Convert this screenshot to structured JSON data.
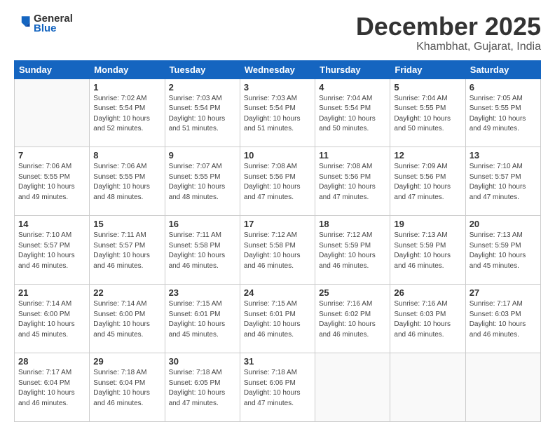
{
  "logo": {
    "general": "General",
    "blue": "Blue"
  },
  "header": {
    "month": "December 2025",
    "location": "Khambhat, Gujarat, India"
  },
  "weekdays": [
    "Sunday",
    "Monday",
    "Tuesday",
    "Wednesday",
    "Thursday",
    "Friday",
    "Saturday"
  ],
  "weeks": [
    [
      {
        "day": "",
        "info": ""
      },
      {
        "day": "1",
        "info": "Sunrise: 7:02 AM\nSunset: 5:54 PM\nDaylight: 10 hours\nand 52 minutes."
      },
      {
        "day": "2",
        "info": "Sunrise: 7:03 AM\nSunset: 5:54 PM\nDaylight: 10 hours\nand 51 minutes."
      },
      {
        "day": "3",
        "info": "Sunrise: 7:03 AM\nSunset: 5:54 PM\nDaylight: 10 hours\nand 51 minutes."
      },
      {
        "day": "4",
        "info": "Sunrise: 7:04 AM\nSunset: 5:54 PM\nDaylight: 10 hours\nand 50 minutes."
      },
      {
        "day": "5",
        "info": "Sunrise: 7:04 AM\nSunset: 5:55 PM\nDaylight: 10 hours\nand 50 minutes."
      },
      {
        "day": "6",
        "info": "Sunrise: 7:05 AM\nSunset: 5:55 PM\nDaylight: 10 hours\nand 49 minutes."
      }
    ],
    [
      {
        "day": "7",
        "info": "Sunrise: 7:06 AM\nSunset: 5:55 PM\nDaylight: 10 hours\nand 49 minutes."
      },
      {
        "day": "8",
        "info": "Sunrise: 7:06 AM\nSunset: 5:55 PM\nDaylight: 10 hours\nand 48 minutes."
      },
      {
        "day": "9",
        "info": "Sunrise: 7:07 AM\nSunset: 5:55 PM\nDaylight: 10 hours\nand 48 minutes."
      },
      {
        "day": "10",
        "info": "Sunrise: 7:08 AM\nSunset: 5:56 PM\nDaylight: 10 hours\nand 47 minutes."
      },
      {
        "day": "11",
        "info": "Sunrise: 7:08 AM\nSunset: 5:56 PM\nDaylight: 10 hours\nand 47 minutes."
      },
      {
        "day": "12",
        "info": "Sunrise: 7:09 AM\nSunset: 5:56 PM\nDaylight: 10 hours\nand 47 minutes."
      },
      {
        "day": "13",
        "info": "Sunrise: 7:10 AM\nSunset: 5:57 PM\nDaylight: 10 hours\nand 47 minutes."
      }
    ],
    [
      {
        "day": "14",
        "info": "Sunrise: 7:10 AM\nSunset: 5:57 PM\nDaylight: 10 hours\nand 46 minutes."
      },
      {
        "day": "15",
        "info": "Sunrise: 7:11 AM\nSunset: 5:57 PM\nDaylight: 10 hours\nand 46 minutes."
      },
      {
        "day": "16",
        "info": "Sunrise: 7:11 AM\nSunset: 5:58 PM\nDaylight: 10 hours\nand 46 minutes."
      },
      {
        "day": "17",
        "info": "Sunrise: 7:12 AM\nSunset: 5:58 PM\nDaylight: 10 hours\nand 46 minutes."
      },
      {
        "day": "18",
        "info": "Sunrise: 7:12 AM\nSunset: 5:59 PM\nDaylight: 10 hours\nand 46 minutes."
      },
      {
        "day": "19",
        "info": "Sunrise: 7:13 AM\nSunset: 5:59 PM\nDaylight: 10 hours\nand 46 minutes."
      },
      {
        "day": "20",
        "info": "Sunrise: 7:13 AM\nSunset: 5:59 PM\nDaylight: 10 hours\nand 45 minutes."
      }
    ],
    [
      {
        "day": "21",
        "info": "Sunrise: 7:14 AM\nSunset: 6:00 PM\nDaylight: 10 hours\nand 45 minutes."
      },
      {
        "day": "22",
        "info": "Sunrise: 7:14 AM\nSunset: 6:00 PM\nDaylight: 10 hours\nand 45 minutes."
      },
      {
        "day": "23",
        "info": "Sunrise: 7:15 AM\nSunset: 6:01 PM\nDaylight: 10 hours\nand 45 minutes."
      },
      {
        "day": "24",
        "info": "Sunrise: 7:15 AM\nSunset: 6:01 PM\nDaylight: 10 hours\nand 46 minutes."
      },
      {
        "day": "25",
        "info": "Sunrise: 7:16 AM\nSunset: 6:02 PM\nDaylight: 10 hours\nand 46 minutes."
      },
      {
        "day": "26",
        "info": "Sunrise: 7:16 AM\nSunset: 6:03 PM\nDaylight: 10 hours\nand 46 minutes."
      },
      {
        "day": "27",
        "info": "Sunrise: 7:17 AM\nSunset: 6:03 PM\nDaylight: 10 hours\nand 46 minutes."
      }
    ],
    [
      {
        "day": "28",
        "info": "Sunrise: 7:17 AM\nSunset: 6:04 PM\nDaylight: 10 hours\nand 46 minutes."
      },
      {
        "day": "29",
        "info": "Sunrise: 7:18 AM\nSunset: 6:04 PM\nDaylight: 10 hours\nand 46 minutes."
      },
      {
        "day": "30",
        "info": "Sunrise: 7:18 AM\nSunset: 6:05 PM\nDaylight: 10 hours\nand 47 minutes."
      },
      {
        "day": "31",
        "info": "Sunrise: 7:18 AM\nSunset: 6:06 PM\nDaylight: 10 hours\nand 47 minutes."
      },
      {
        "day": "",
        "info": ""
      },
      {
        "day": "",
        "info": ""
      },
      {
        "day": "",
        "info": ""
      }
    ]
  ]
}
